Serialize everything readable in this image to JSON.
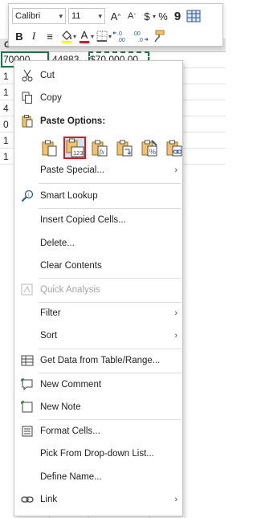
{
  "toolbar": {
    "font_name": "Calibri",
    "font_size": "11",
    "grow_font": "A",
    "shrink_font": "A",
    "currency": "$",
    "percent": "%",
    "comma": "9",
    "bold": "B",
    "italic": "I",
    "align": "≡",
    "font_color_letter": "A",
    "decimal_inc": "←0 .00",
    "decimal_dec": ".00 →0",
    "fill_color": "#ffff00",
    "font_color": "#e3161d"
  },
  "sheet": {
    "col_header": "C",
    "cells": [
      "70000",
      "44883",
      "$70,000.00",
      "1",
      "1",
      "4",
      "0",
      "1",
      "1"
    ]
  },
  "menu": {
    "cut": "Cut",
    "copy": "Copy",
    "paste_options": "Paste Options:",
    "paste_values_badge": "123",
    "paste_special": "Paste Special...",
    "smart_lookup": "Smart Lookup",
    "insert_copied": "Insert Copied Cells...",
    "delete": "Delete...",
    "clear": "Clear Contents",
    "quick_analysis": "Quick Analysis",
    "filter": "Filter",
    "sort": "Sort",
    "get_data": "Get Data from Table/Range...",
    "new_comment": "New Comment",
    "new_note": "New Note",
    "format_cells": "Format Cells...",
    "pick_list": "Pick From Drop-down List...",
    "define_name": "Define Name...",
    "link": "Link",
    "submenu_arrow": "›"
  },
  "colors": {
    "accent": "#2b579a",
    "selected_border": "#e3161d",
    "cell_border": "#217346"
  }
}
